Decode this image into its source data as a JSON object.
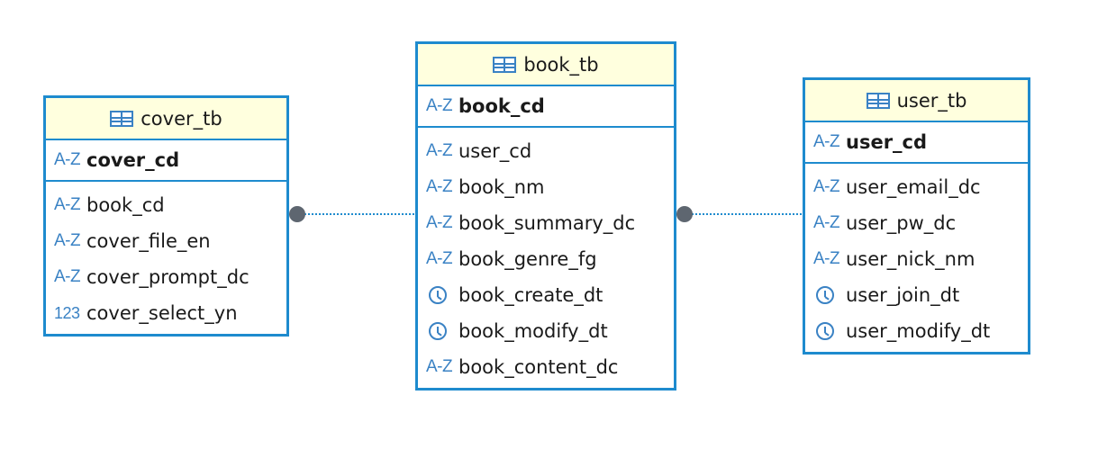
{
  "entities": {
    "cover_tb": {
      "name": "cover_tb",
      "primary_key": {
        "type_icon": "A-Z",
        "name": "cover_cd"
      },
      "columns": [
        {
          "type_icon": "A-Z",
          "name": "book_cd"
        },
        {
          "type_icon": "A-Z",
          "name": "cover_file_en"
        },
        {
          "type_icon": "A-Z",
          "name": "cover_prompt_dc"
        },
        {
          "type_icon": "123",
          "name": "cover_select_yn"
        }
      ]
    },
    "book_tb": {
      "name": "book_tb",
      "primary_key": {
        "type_icon": "A-Z",
        "name": "book_cd"
      },
      "columns": [
        {
          "type_icon": "A-Z",
          "name": "user_cd"
        },
        {
          "type_icon": "A-Z",
          "name": "book_nm"
        },
        {
          "type_icon": "A-Z",
          "name": "book_summary_dc"
        },
        {
          "type_icon": "A-Z",
          "name": "book_genre_fg"
        },
        {
          "type_icon": "clock-icon",
          "name": "book_create_dt"
        },
        {
          "type_icon": "clock-icon",
          "name": "book_modify_dt"
        },
        {
          "type_icon": "A-Z",
          "name": "book_content_dc"
        }
      ]
    },
    "user_tb": {
      "name": "user_tb",
      "primary_key": {
        "type_icon": "A-Z",
        "name": "user_cd"
      },
      "columns": [
        {
          "type_icon": "A-Z",
          "name": "user_email_dc"
        },
        {
          "type_icon": "A-Z",
          "name": "user_pw_dc"
        },
        {
          "type_icon": "A-Z",
          "name": "user_nick_nm"
        },
        {
          "type_icon": "clock-icon",
          "name": "user_join_dt"
        },
        {
          "type_icon": "clock-icon",
          "name": "user_modify_dt"
        }
      ]
    }
  },
  "relationships": [
    {
      "from": "cover_tb",
      "to": "book_tb",
      "line_style": "dotted",
      "end_marker": "filled-circle"
    },
    {
      "from": "book_tb",
      "to": "user_tb",
      "line_style": "dotted",
      "end_marker": "filled-circle"
    }
  ],
  "colors": {
    "border": "#1e8bce",
    "header_bg": "#ffffde",
    "icon": "#3a82c4",
    "connector_dot": "#5e6670",
    "connector_line": "#1e8bce"
  }
}
